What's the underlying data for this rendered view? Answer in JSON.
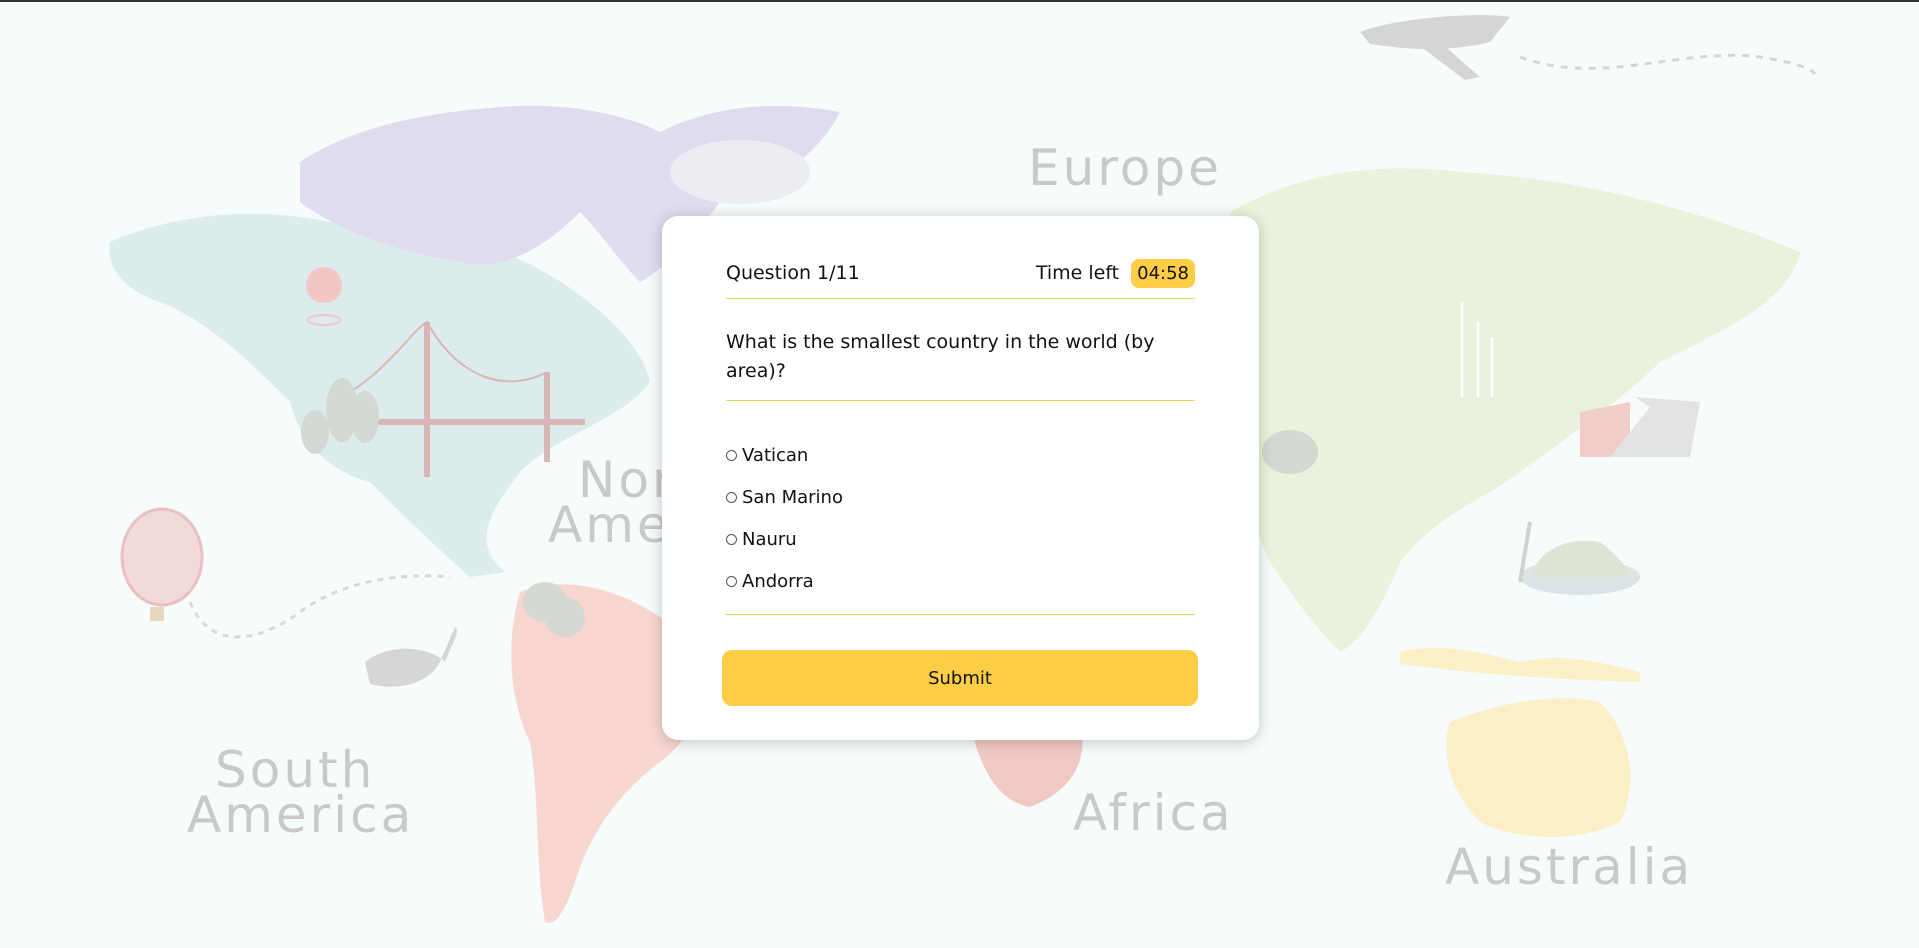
{
  "map": {
    "labels": {
      "europe": "Europe",
      "north_america_line1": "North",
      "north_america_line2": "America",
      "south_america_line1": "South",
      "south_america_line2": "America",
      "africa": "Africa",
      "australia": "Australia"
    },
    "colors": {
      "north_america": "#dcebeb",
      "arctic": "#e0dbef",
      "south_america": "#f7d6cf",
      "asia": "#e9f2da",
      "africa": "#f1c9c4",
      "australia": "#fbefc8",
      "decor": "#d8d8d8"
    }
  },
  "quiz": {
    "question_counter": "Question 1/11",
    "time_label": "Time left",
    "time_value": "04:58",
    "question_text": "What is the smallest country in the world (by area)?",
    "options": [
      "Vatican",
      "San Marino",
      "Nauru",
      "Andorra"
    ],
    "submit_label": "Submit",
    "accent_color": "#fdcd46"
  }
}
